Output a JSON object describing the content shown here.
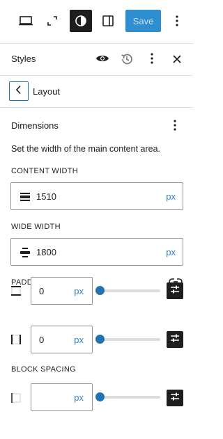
{
  "toolbar": {
    "save_label": "Save",
    "icons": [
      "laptop-icon",
      "fullscreen-icon",
      "contrast-icon",
      "sidebar-icon",
      "more-vertical-icon"
    ],
    "accent": "#2f8ed0"
  },
  "styles_header": {
    "title": "Styles",
    "icons": [
      "eye-icon",
      "history-icon",
      "more-vertical-icon",
      "close-icon"
    ]
  },
  "layout_header": {
    "title": "Layout"
  },
  "dimensions": {
    "title": "Dimensions",
    "description": "Set the width of the main content area.",
    "content_width": {
      "label": "CONTENT WIDTH",
      "value": "1510",
      "unit": "px"
    },
    "wide_width": {
      "label": "WIDE WIDTH",
      "value": "1800",
      "unit": "px"
    },
    "padding": {
      "label": "PADDING",
      "rows": [
        {
          "value": "0",
          "unit": "px",
          "slider_fraction": 0
        },
        {
          "value": "0",
          "unit": "px",
          "slider_fraction": 0
        }
      ]
    },
    "block_spacing": {
      "label": "BLOCK SPACING",
      "value": "",
      "unit": "px",
      "slider_fraction": 0
    }
  }
}
